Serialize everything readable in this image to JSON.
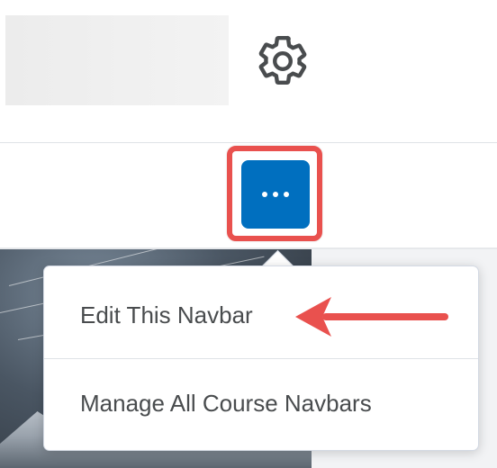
{
  "header": {
    "settings_icon": "gear-icon"
  },
  "navbar": {
    "more_button_icon": "ellipsis-icon"
  },
  "menu": {
    "items": [
      {
        "label": "Edit This Navbar"
      },
      {
        "label": "Manage All Course Navbars"
      }
    ]
  },
  "annotation": {
    "highlight_color": "#e9514e",
    "arrow_color": "#e9514e"
  },
  "colors": {
    "accent": "#006fbf",
    "text": "#494c4e"
  }
}
